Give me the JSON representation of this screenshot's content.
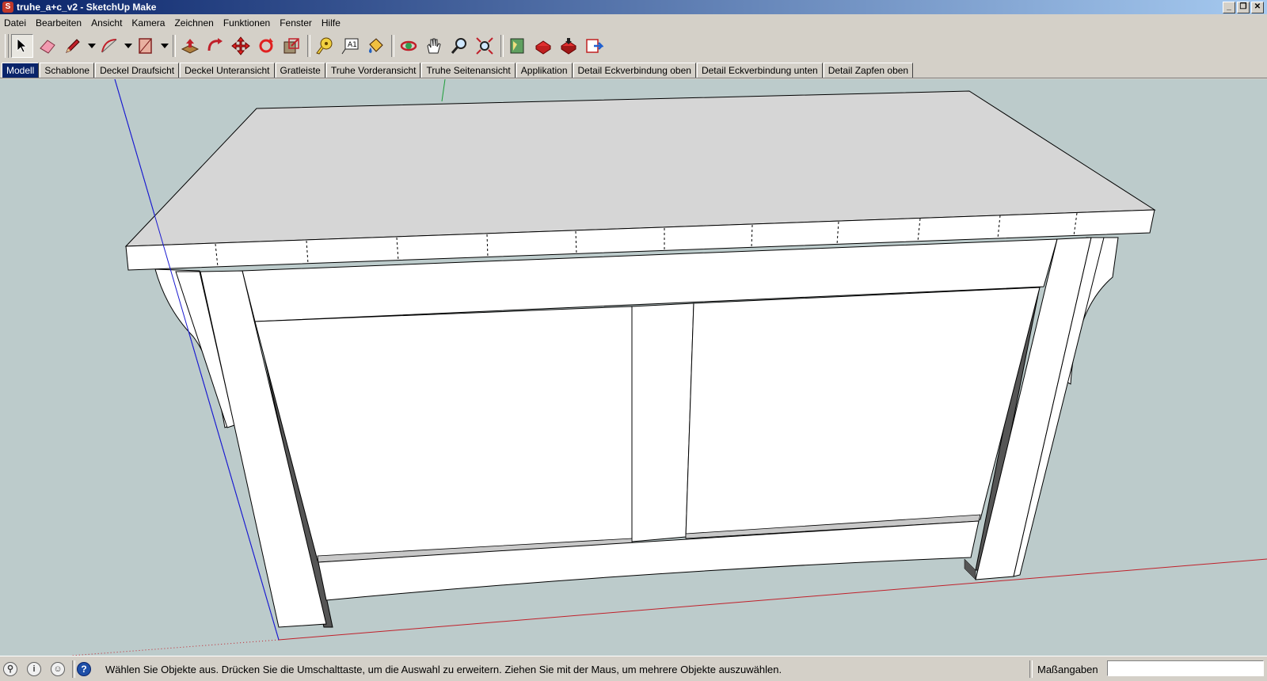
{
  "window": {
    "title": "truhe_a+c_v2 - SketchUp Make",
    "app_icon": "sketchup-logo-icon"
  },
  "window_buttons": [
    "minimize",
    "restore",
    "close"
  ],
  "menu": [
    "Datei",
    "Bearbeiten",
    "Ansicht",
    "Kamera",
    "Zeichnen",
    "Funktionen",
    "Fenster",
    "Hilfe"
  ],
  "toolbar": {
    "tools": [
      {
        "name": "select-tool-icon",
        "active": true
      },
      {
        "name": "eraser-tool-icon"
      },
      {
        "name": "pencil-line-tool-icon"
      },
      {
        "name": "arc-tool-icon"
      },
      {
        "name": "rectangle-tool-icon"
      },
      {
        "name": "push-pull-tool-icon"
      },
      {
        "name": "follow-me-tool-icon"
      },
      {
        "name": "move-tool-icon"
      },
      {
        "name": "rotate-tool-icon"
      },
      {
        "name": "scale-tool-icon"
      },
      {
        "name": "tape-measure-tool-icon"
      },
      {
        "name": "text-tool-icon"
      },
      {
        "name": "paint-bucket-tool-icon"
      },
      {
        "name": "orbit-tool-icon"
      },
      {
        "name": "pan-tool-icon"
      },
      {
        "name": "zoom-tool-icon"
      },
      {
        "name": "zoom-extents-tool-icon"
      },
      {
        "name": "3d-warehouse-icon"
      },
      {
        "name": "share-model-icon"
      },
      {
        "name": "get-models-icon"
      },
      {
        "name": "extension-warehouse-icon"
      }
    ]
  },
  "scenes": {
    "tabs": [
      "Modell",
      "Schablone",
      "Deckel Draufsicht",
      "Deckel Unteransicht",
      "Gratleiste",
      "Truhe Vorderansicht",
      "Truhe Seitenansicht",
      "Applikation",
      "Detail Eckverbindung oben",
      "Detail Eckverbindung unten",
      "Detail Zapfen oben"
    ],
    "active_index": 0
  },
  "status": {
    "icons": [
      "geo-location-icon",
      "credits-info-icon",
      "user-account-icon"
    ],
    "help_icon": "help-icon",
    "text": "Wählen Sie Objekte aus. Drücken Sie die Umschalttaste, um die Auswahl zu erweitern. Ziehen Sie mit der Maus, um mehrere Objekte auszuwählen.",
    "measurements_label": "Maßangaben",
    "measurements_value": ""
  },
  "colors": {
    "viewport_bg": "#bccbcb",
    "red_axis": "#c0202a",
    "green_axis": "#1e9e3a",
    "blue_axis": "#1a1ad0",
    "lid_top": "#d6d6d6",
    "face": "#ffffff"
  }
}
